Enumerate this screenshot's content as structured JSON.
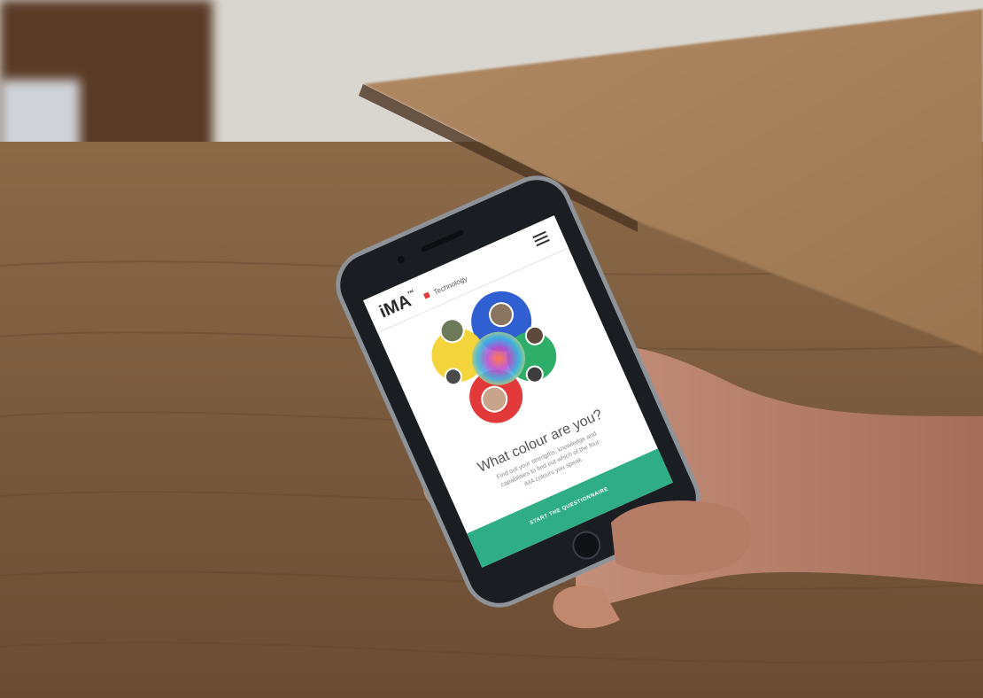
{
  "app": {
    "logo_text": "iMA",
    "logo_superscript": "™",
    "logo_suffix": "Technology"
  },
  "hero": {
    "headline": "What colour are you?",
    "body_lines": [
      "Find out your strengths, knowledge and",
      "capabilities to find out which of the four",
      "iMA colours you speak."
    ]
  },
  "cta": {
    "label": "START THE QUESTIONNAIRE"
  },
  "colors": {
    "app_header_bg": "#ffffff",
    "cta_bg": "#2fae86",
    "circle_blue": "#2f5fd0",
    "circle_yellow": "#f3d43a",
    "circle_green": "#2fae6a",
    "circle_red": "#e23a3a",
    "phone_body": "#1a1d22"
  },
  "icons": {
    "menu": "hamburger-menu-icon",
    "logo": "ima-logo-icon"
  }
}
